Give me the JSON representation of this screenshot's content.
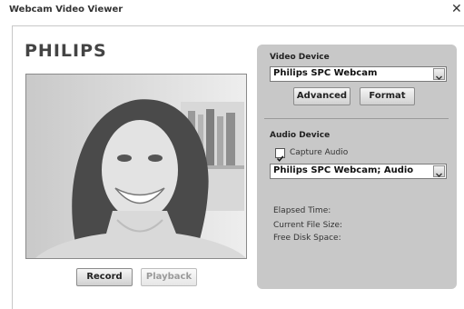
{
  "window": {
    "title": "Webcam Video Viewer"
  },
  "brand": {
    "logo_text": "PHILIPS"
  },
  "controls": {
    "record_label": "Record",
    "playback_label": "Playback"
  },
  "video_device": {
    "heading": "Video Device",
    "selected": "Philips SPC Webcam",
    "advanced_label": "Advanced",
    "format_label": "Format"
  },
  "audio_device": {
    "heading": "Audio Device",
    "capture_audio_label": "Capture Audio",
    "capture_audio_checked": true,
    "selected": "Philips SPC Webcam; Audio"
  },
  "stats": {
    "elapsed_time_label": "Elapsed Time:",
    "current_file_size_label": "Current File Size:",
    "free_disk_space_label": "Free Disk Space:"
  },
  "icons": [
    "close-icon",
    "dropdown-arrow-icon",
    "checkmark-icon"
  ]
}
